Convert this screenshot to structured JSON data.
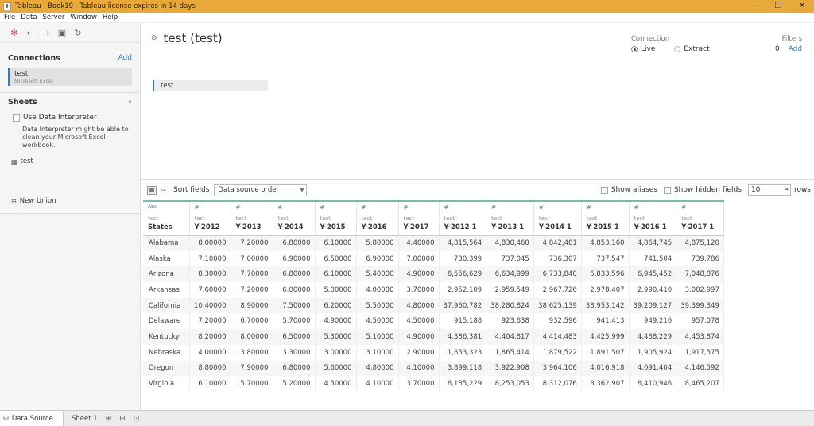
{
  "window": {
    "title": "Tableau - Book19 - Tableau license expires in 14 days",
    "minimize": "—",
    "maximize": "❐",
    "close": "✕"
  },
  "menu": [
    "File",
    "Data",
    "Server",
    "Window",
    "Help"
  ],
  "left": {
    "connections_label": "Connections",
    "add_label": "Add",
    "connection": {
      "name": "test",
      "type": "Microsoft Excel"
    },
    "sheets_label": "Sheets",
    "use_interpreter_label": "Use Data Interpreter",
    "interpreter_text": "Data Interpreter might be able to clean your Microsoft Excel workbook.",
    "sheet_item": "test",
    "new_union": "New Union"
  },
  "canvas": {
    "title": "test (test)",
    "connection_label": "Connection",
    "live_label": "Live",
    "extract_label": "Extract",
    "filters_label": "Filters",
    "filters_count": "0",
    "filters_add": "Add",
    "table_name": "test"
  },
  "gridbar": {
    "sort_label": "Sort fields",
    "sort_value": "Data source order",
    "show_aliases": "Show aliases",
    "show_hidden": "Show hidden fields",
    "rows_value": "10",
    "rows_label": "rows"
  },
  "grid": {
    "columns": [
      {
        "type": "Abc",
        "source": "test",
        "name": "States"
      },
      {
        "type": "#",
        "source": "test",
        "name": "Y-2012"
      },
      {
        "type": "#",
        "source": "test",
        "name": "Y-2013"
      },
      {
        "type": "#",
        "source": "test",
        "name": "Y-2014"
      },
      {
        "type": "#",
        "source": "test",
        "name": "Y-2015"
      },
      {
        "type": "#",
        "source": "test",
        "name": "Y-2016"
      },
      {
        "type": "#",
        "source": "test",
        "name": "Y-2017"
      },
      {
        "type": "#",
        "source": "test",
        "name": "Y-2012 1"
      },
      {
        "type": "#",
        "source": "test",
        "name": "Y-2013 1"
      },
      {
        "type": "#",
        "source": "test",
        "name": "Y-2014 1"
      },
      {
        "type": "#",
        "source": "test",
        "name": "Y-2015 1"
      },
      {
        "type": "#",
        "source": "test",
        "name": "Y-2016 1"
      },
      {
        "type": "#",
        "source": "test",
        "name": "Y-2017 1"
      }
    ],
    "rows": [
      [
        "Alabama",
        "8.00000",
        "7.20000",
        "6.80000",
        "6.10000",
        "5.80000",
        "4.40000",
        "4,815,564",
        "4,830,460",
        "4,842,481",
        "4,853,160",
        "4,864,745",
        "4,875,120"
      ],
      [
        "Alaska",
        "7.10000",
        "7.00000",
        "6.90000",
        "6.50000",
        "6.90000",
        "7.00000",
        "730,399",
        "737,045",
        "736,307",
        "737,547",
        "741,504",
        "739,786"
      ],
      [
        "Arizona",
        "8.30000",
        "7.70000",
        "6.80000",
        "6.10000",
        "5.40000",
        "4.90000",
        "6,556,629",
        "6,634,999",
        "6,733,840",
        "6,833,596",
        "6,945,452",
        "7,048,876"
      ],
      [
        "Arkansas",
        "7.60000",
        "7.20000",
        "6.00000",
        "5.00000",
        "4.00000",
        "3.70000",
        "2,952,109",
        "2,959,549",
        "2,967,726",
        "2,978,407",
        "2,990,410",
        "3,002,997"
      ],
      [
        "California",
        "10.40000",
        "8.90000",
        "7.50000",
        "6.20000",
        "5.50000",
        "4.80000",
        "37,960,782",
        "38,280,824",
        "38,625,139",
        "38,953,142",
        "39,209,127",
        "39,399,349"
      ],
      [
        "Delaware",
        "7.20000",
        "6.70000",
        "5.70000",
        "4.90000",
        "4.50000",
        "4.50000",
        "915,188",
        "923,638",
        "932,596",
        "941,413",
        "949,216",
        "957,078"
      ],
      [
        "Kentucky",
        "8.20000",
        "8.00000",
        "6.50000",
        "5.30000",
        "5.10000",
        "4.90000",
        "4,386,381",
        "4,404,817",
        "4,414,483",
        "4,425,999",
        "4,438,229",
        "4,453,874"
      ],
      [
        "Nebraska",
        "4.00000",
        "3.80000",
        "3.30000",
        "3.00000",
        "3.10000",
        "2.90000",
        "1,853,323",
        "1,865,414",
        "1,879,522",
        "1,891,507",
        "1,905,924",
        "1,917,575"
      ],
      [
        "Oregon",
        "8.80000",
        "7.90000",
        "6.80000",
        "5.60000",
        "4.80000",
        "4.10000",
        "3,899,118",
        "3,922,908",
        "3,964,106",
        "4,016,918",
        "4,091,404",
        "4,146,592"
      ],
      [
        "Virginia",
        "6.10000",
        "5.70000",
        "5.20000",
        "4.50000",
        "4.10000",
        "3.70000",
        "8,185,229",
        "8,253,053",
        "8,312,076",
        "8,362,907",
        "8,410,946",
        "8,465,207"
      ]
    ]
  },
  "tabs": {
    "data_source": "Data Source",
    "sheet1": "Sheet 1"
  }
}
